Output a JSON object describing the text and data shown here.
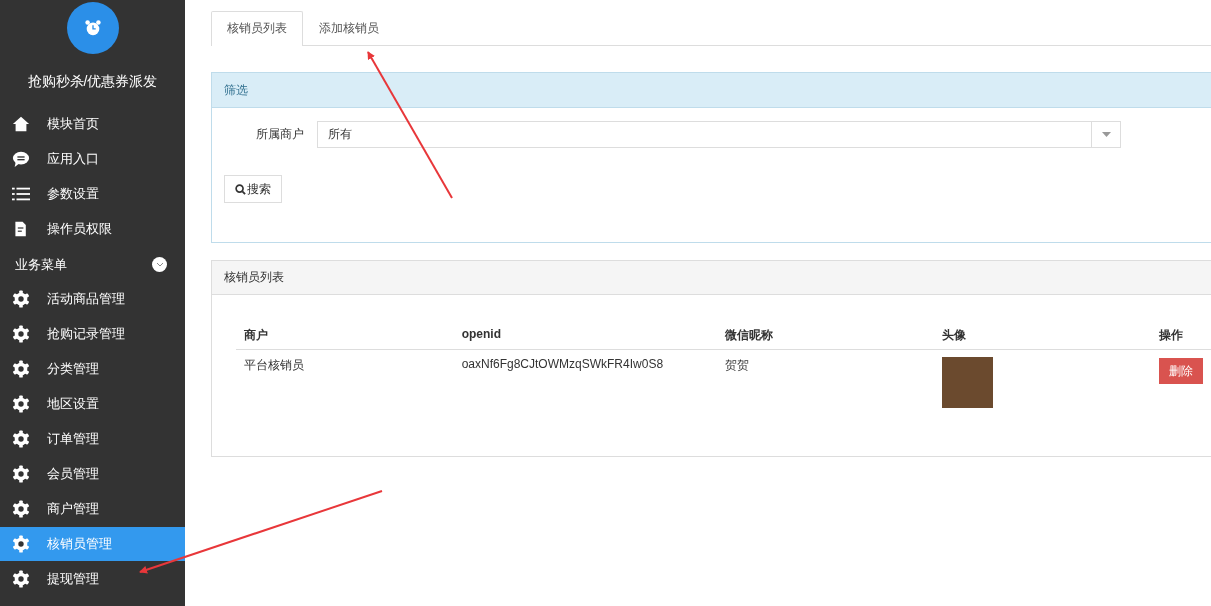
{
  "sidebar": {
    "app_title": "抢购秒杀/优惠券派发",
    "items": [
      {
        "label": "模块首页",
        "kind": "home",
        "selected": false
      },
      {
        "label": "应用入口",
        "kind": "chat",
        "selected": false
      },
      {
        "label": "参数设置",
        "kind": "list",
        "selected": false
      },
      {
        "label": "操作员权限",
        "kind": "doc",
        "selected": false
      }
    ],
    "section": {
      "label": "业务菜单"
    },
    "section_items": [
      {
        "label": "活动商品管理",
        "kind": "gear",
        "selected": false
      },
      {
        "label": "抢购记录管理",
        "kind": "gear",
        "selected": false
      },
      {
        "label": "分类管理",
        "kind": "gear",
        "selected": false
      },
      {
        "label": "地区设置",
        "kind": "gear",
        "selected": false
      },
      {
        "label": "订单管理",
        "kind": "gear",
        "selected": false
      },
      {
        "label": "会员管理",
        "kind": "gear",
        "selected": false
      },
      {
        "label": "商户管理",
        "kind": "gear",
        "selected": false
      },
      {
        "label": "核销员管理",
        "kind": "gear",
        "selected": true
      },
      {
        "label": "提现管理",
        "kind": "gear",
        "selected": false
      }
    ]
  },
  "tabs": [
    {
      "label": "核销员列表",
      "selected": true
    },
    {
      "label": "添加核销员",
      "selected": false
    }
  ],
  "filter": {
    "title": "筛选",
    "field_label": "所属商户",
    "select_value": "所有",
    "search_button": "搜索"
  },
  "table": {
    "title": "核销员列表",
    "columns": [
      "商户",
      "openid",
      "微信昵称",
      "头像",
      "操作"
    ],
    "rows": [
      {
        "merchant": "平台核销员",
        "openid": "oaxNf6Fg8CJtOWMzqSWkFR4Iw0S8",
        "nickname": "贺贺",
        "action": "删除"
      }
    ]
  }
}
